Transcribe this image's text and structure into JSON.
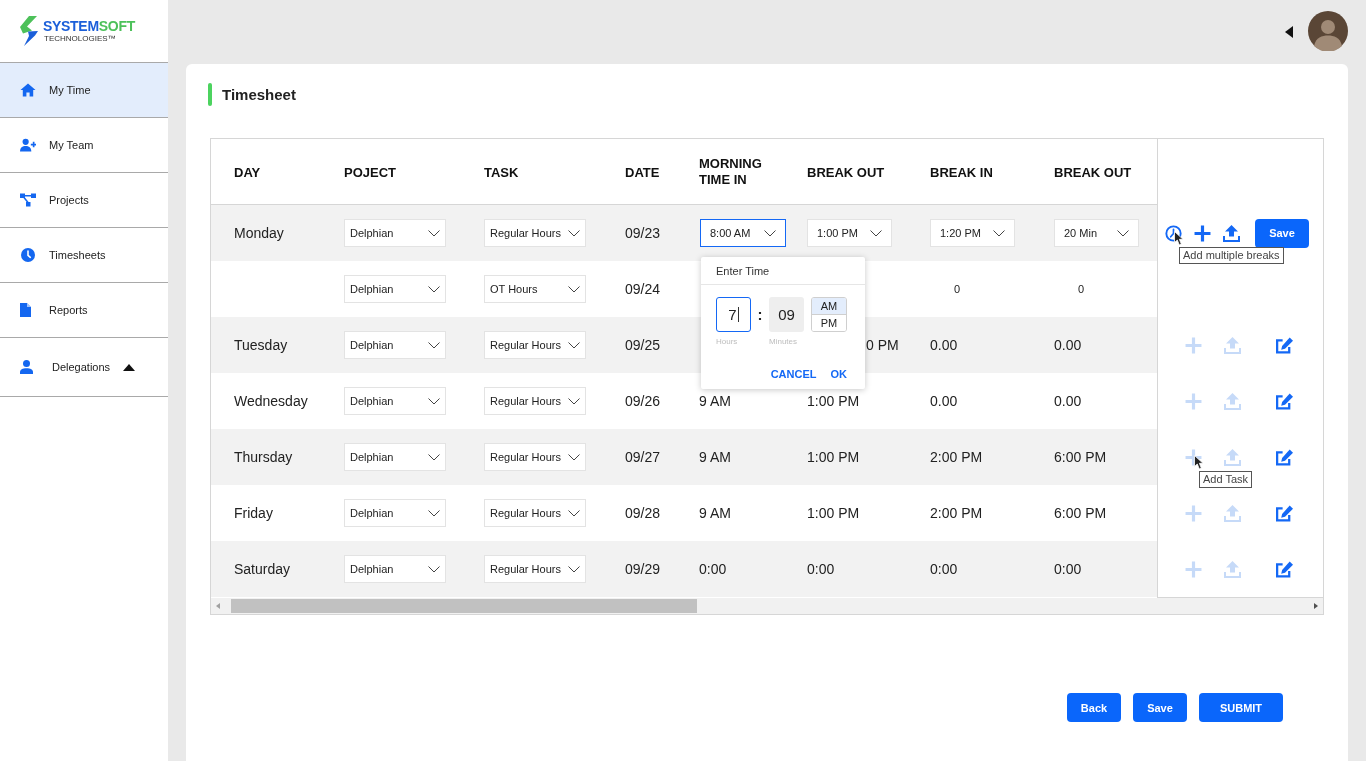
{
  "brand": {
    "name_parts": [
      "SYSTEM",
      "SOFT"
    ],
    "tagline": "TECHNOLOGIES™"
  },
  "sidebar": {
    "items": [
      {
        "label": "My Time",
        "selected": true
      },
      {
        "label": "My Team",
        "selected": false
      },
      {
        "label": "Projects",
        "selected": false
      },
      {
        "label": "Timesheets",
        "selected": false
      },
      {
        "label": "Reports",
        "selected": false
      },
      {
        "label": "Delegations",
        "selected": false,
        "has_submenu": true
      }
    ]
  },
  "page_title": "Timesheet",
  "table": {
    "columns": [
      "DAY",
      "POJECT",
      "TASK",
      "DATE",
      "MORNING TIME IN",
      "BREAK OUT",
      "BREAK IN",
      "BREAK OUT"
    ],
    "rows": [
      {
        "day": "Monday",
        "project": {
          "value": "Delphian",
          "active": false
        },
        "task": {
          "value": "Regular Hours",
          "active": false
        },
        "date": "09/23",
        "morning_in": {
          "kind": "select",
          "value": "8:00 AM",
          "active": true
        },
        "break_out": {
          "kind": "select",
          "value": "1:00 PM",
          "active": false
        },
        "break_in": {
          "kind": "select",
          "value": "1:20 PM",
          "active": false
        },
        "break_out_2": {
          "kind": "select",
          "value": "20 Min",
          "active": false
        },
        "actions": [
          {
            "kind": "breaks",
            "tooltip": "Add multiple breaks"
          },
          {
            "kind": "add",
            "disabled": false
          },
          {
            "kind": "upload",
            "disabled": false
          },
          {
            "kind": "save",
            "label": "Save"
          }
        ]
      },
      {
        "project": {
          "value": "Delphian",
          "active": false
        },
        "task": {
          "value": "OT Hours",
          "active": false
        },
        "date": "09/24",
        "break_in": {
          "kind": "count",
          "value": "0"
        },
        "break_out_2": {
          "kind": "count",
          "value": "0"
        }
      },
      {
        "day": "Tuesday",
        "project": {
          "value": "Delphian",
          "active": false
        },
        "task": {
          "value": "Regular Hours",
          "active": false
        },
        "date": "09/25",
        "break_out": {
          "kind": "partial",
          "value": "0 PM"
        },
        "break_in": {
          "kind": "text",
          "value": "0.00"
        },
        "break_out_2": {
          "kind": "text",
          "value": "0.00"
        },
        "actions": [
          {
            "kind": "add",
            "disabled": true
          },
          {
            "kind": "upload",
            "disabled": true
          },
          {
            "kind": "edit",
            "disabled": false
          }
        ]
      },
      {
        "day": "Wednesday",
        "project": {
          "value": "Delphian",
          "active": false
        },
        "task": {
          "value": "Regular Hours",
          "active": false
        },
        "date": "09/26",
        "morning_in": {
          "kind": "text",
          "value": "9 AM"
        },
        "break_out": {
          "kind": "text",
          "value": "1:00 PM"
        },
        "break_in": {
          "kind": "text",
          "value": "0.00"
        },
        "break_out_2": {
          "kind": "text",
          "value": "0.00"
        },
        "actions": [
          {
            "kind": "add",
            "disabled": true
          },
          {
            "kind": "upload",
            "disabled": true
          },
          {
            "kind": "edit",
            "disabled": false
          }
        ]
      },
      {
        "day": "Thursday",
        "project": {
          "value": "Delphian",
          "active": false
        },
        "task": {
          "value": "Regular Hours",
          "active": false
        },
        "date": "09/27",
        "morning_in": {
          "kind": "text",
          "value": "9 AM"
        },
        "break_out": {
          "kind": "text",
          "value": "1:00 PM"
        },
        "break_in": {
          "kind": "text",
          "value": "2:00 PM"
        },
        "break_out_2": {
          "kind": "text",
          "value": "6:00 PM"
        },
        "actions": [
          {
            "kind": "add",
            "disabled": true,
            "tooltip": "Add Task"
          },
          {
            "kind": "upload",
            "disabled": true
          },
          {
            "kind": "edit",
            "disabled": false
          }
        ]
      },
      {
        "day": "Friday",
        "project": {
          "value": "Delphian",
          "active": false
        },
        "task": {
          "value": "Regular Hours",
          "active": false
        },
        "date": "09/28",
        "morning_in": {
          "kind": "text",
          "value": "9 AM"
        },
        "break_out": {
          "kind": "text",
          "value": "1:00 PM"
        },
        "break_in": {
          "kind": "text",
          "value": "2:00 PM"
        },
        "break_out_2": {
          "kind": "text",
          "value": "6:00 PM"
        },
        "actions": [
          {
            "kind": "add",
            "disabled": true
          },
          {
            "kind": "upload",
            "disabled": true
          },
          {
            "kind": "edit",
            "disabled": false
          }
        ]
      },
      {
        "day": "Saturday",
        "project": {
          "value": "Delphian",
          "active": false
        },
        "task": {
          "value": "Regular Hours",
          "active": false
        },
        "date": "09/29",
        "morning_in": {
          "kind": "text",
          "value": "0:00"
        },
        "break_out": {
          "kind": "text",
          "value": "0:00"
        },
        "break_in": {
          "kind": "text",
          "value": "0:00"
        },
        "break_out_2": {
          "kind": "text",
          "value": "0:00"
        },
        "actions": [
          {
            "kind": "add",
            "disabled": true
          },
          {
            "kind": "upload",
            "disabled": true
          },
          {
            "kind": "edit",
            "disabled": false
          }
        ]
      }
    ],
    "time_picker": {
      "title": "Enter Time",
      "hours": "7",
      "separator": ":",
      "minutes": "09",
      "periods": [
        {
          "label": "AM",
          "selected": true
        },
        {
          "label": "PM",
          "selected": false
        }
      ],
      "hours_label": "Hours",
      "minutes_label": "Minutes",
      "buttons": [
        "CANCEL",
        "OK"
      ]
    }
  },
  "footer_buttons": [
    "Back",
    "Save",
    "SUBMIT"
  ]
}
